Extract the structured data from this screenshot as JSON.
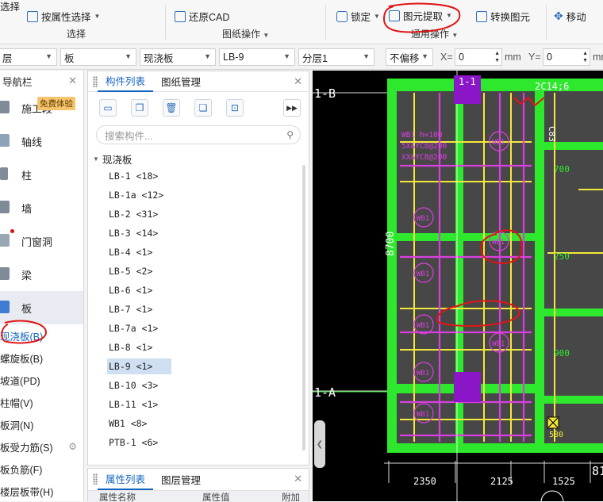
{
  "ribbon": {
    "select_partial": "选择",
    "select_by_attr": "按属性选择",
    "select_group": "选择",
    "restore_cad": "还原CAD",
    "drawing_ops_group": "图纸操作",
    "lock": "锁定",
    "extract": "图元提取",
    "convert": "转换图元",
    "common_ops_group": "通用操作",
    "move": "移动"
  },
  "filters": {
    "layer_partial": "层",
    "category": "板",
    "type": "现浇板",
    "item": "LB-9",
    "floor": "分层1",
    "offset": "不偏移",
    "x_label": "X=",
    "x_value": "0",
    "x_unit": "mm",
    "y_label": "Y=",
    "y_value": "0",
    "y_unit": "mm"
  },
  "nav": {
    "title": "导航栏",
    "badge": "免费体验",
    "items": [
      {
        "label": "施工段"
      },
      {
        "label": "轴线"
      },
      {
        "label": "柱"
      },
      {
        "label": "墙"
      },
      {
        "label": "门窗洞"
      },
      {
        "label": "梁"
      },
      {
        "label": "板"
      }
    ],
    "subs": [
      {
        "label": "现浇板(B)"
      },
      {
        "label": "螺旋板(B)"
      },
      {
        "label": "坡道(PD)"
      },
      {
        "label": "柱帽(V)"
      },
      {
        "label": "板洞(N)"
      },
      {
        "label": "板受力筋(S)"
      },
      {
        "label": "板负筋(F)"
      },
      {
        "label": "楼层板带(H)"
      }
    ]
  },
  "components": {
    "tab_list": "构件列表",
    "tab_drawing": "图纸管理",
    "search_placeholder": "搜索构件...",
    "group": "现浇板",
    "items": [
      "LB-1 <18>",
      "LB-1a <12>",
      "LB-2 <31>",
      "LB-3 <14>",
      "LB-4 <1>",
      "LB-5 <2>",
      "LB-6 <1>",
      "LB-7 <1>",
      "LB-7a <1>",
      "LB-8 <1>",
      "LB-9 <1>",
      "LB-10 <3>",
      "LB-11 <1>",
      "WB1 <8>",
      "PTB-1 <6>"
    ]
  },
  "props": {
    "tab_props": "属性列表",
    "tab_layers": "图层管理",
    "col_name": "属性名称",
    "col_value": "属性值",
    "col_extra": "附加"
  },
  "canvas": {
    "axis_b": "1-B",
    "axis_a": "1-A",
    "rebar": "2C14;6",
    "dim_8700": "8700",
    "dims": [
      "2350",
      "2125",
      "1525",
      "81"
    ],
    "wb1": "WB1",
    "note1": "WB1 h=100",
    "note2": "5X&YC8@200",
    "note3": "XX&YC8@200",
    "d700": "700",
    "d250": "250",
    "d900": "900",
    "d580": "580",
    "c83": "C83",
    "d1_1": "1-1"
  },
  "colors": {
    "green": "#2ee82e",
    "yellow": "#f2e93a",
    "magenta": "#d93fe0",
    "slab": "#4a4a4a",
    "purple": "#8b16c8",
    "red_annot": "#e01515"
  }
}
